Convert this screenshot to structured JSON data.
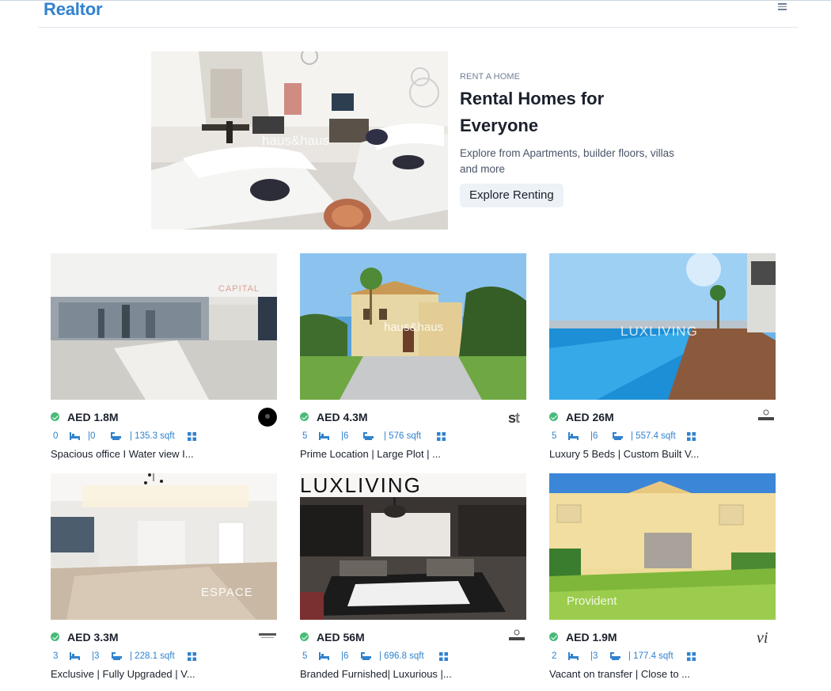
{
  "brand": "Realtor",
  "hero": {
    "eyebrow": "RENT A HOME",
    "title_line1": "Rental Homes for",
    "title_line2": "Everyone",
    "desc_line1": "Explore from Apartments, builder floors, villas",
    "desc_line2": "and more",
    "button": "Explore Renting",
    "watermark": "haus&haus"
  },
  "colors": {
    "accent": "#3182ce",
    "verified": "#48bb78"
  },
  "listings": [
    {
      "price": "AED 1.8M",
      "rooms": "0",
      "baths": "|0",
      "area": "| 135.3 sqft",
      "title": "Spacious office I Water view I...",
      "watermark": "CAPITAL"
    },
    {
      "price": "AED 4.3M",
      "rooms": "5",
      "baths": "|6",
      "area": "| 576 sqft",
      "title": "Prime Location | Large Plot | ...",
      "watermark": "haus&haus"
    },
    {
      "price": "AED 26M",
      "rooms": "5",
      "baths": "|6",
      "area": "| 557.4 sqft",
      "title": "Luxury 5 Beds | Custom Built V...",
      "watermark": "LUXLIVING"
    },
    {
      "price": "AED 3.3M",
      "rooms": "3",
      "baths": "|3",
      "area": "| 228.1 sqft",
      "title": "Exclusive | Fully Upgraded | V...",
      "watermark": "ESPACE"
    },
    {
      "price": "AED 56M",
      "rooms": "5",
      "baths": "|6",
      "area": "| 696.8 sqft",
      "title": "Branded Furnished| Luxurious |...",
      "watermark": "LUXLIVING"
    },
    {
      "price": "AED 1.9M",
      "rooms": "2",
      "baths": "|3",
      "area": "| 177.4 sqft",
      "title": "Vacant on transfer | Close to ...",
      "watermark": "Provident"
    }
  ]
}
